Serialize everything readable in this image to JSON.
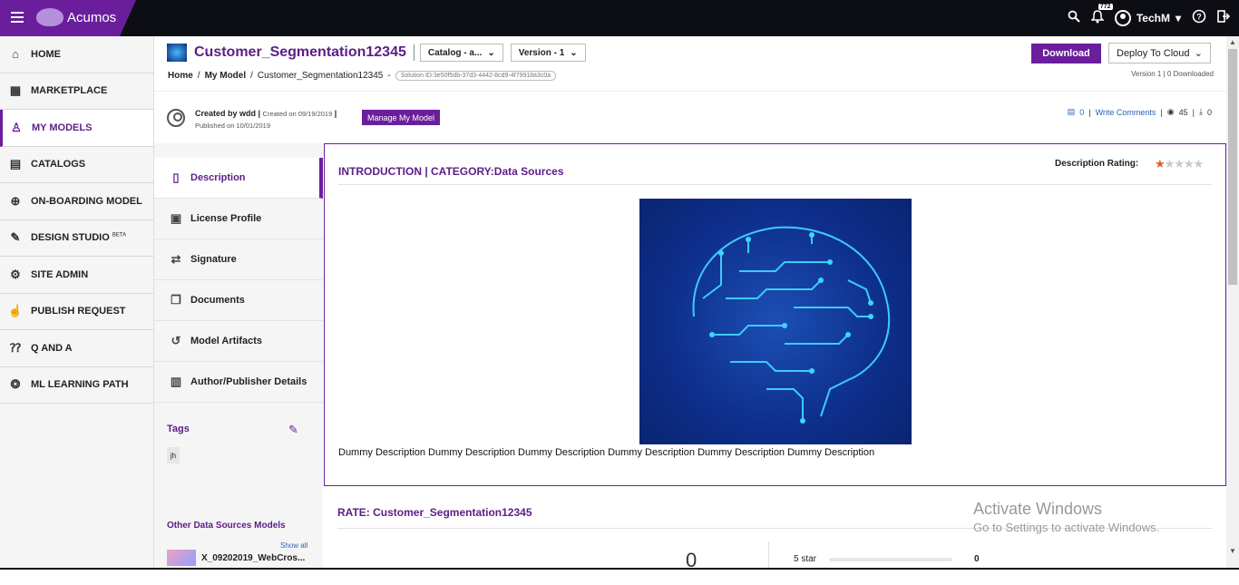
{
  "topbar": {
    "brand": "Acumos",
    "notification_count": "772",
    "user_name": "TechM"
  },
  "sidebar": {
    "items": [
      {
        "label": "HOME",
        "icon": "home-icon"
      },
      {
        "label": "MARKETPLACE",
        "icon": "store-icon"
      },
      {
        "label": "MY MODELS",
        "icon": "person-icon"
      },
      {
        "label": "CATALOGS",
        "icon": "catalog-icon"
      },
      {
        "label": "ON-BOARDING MODEL",
        "icon": "onboarding-icon"
      },
      {
        "label": "DESIGN STUDIO",
        "icon": "design-icon",
        "sup": "BETA"
      },
      {
        "label": "SITE ADMIN",
        "icon": "admin-icon"
      },
      {
        "label": "PUBLISH REQUEST",
        "icon": "publish-icon"
      },
      {
        "label": "Q AND A",
        "icon": "qa-icon"
      },
      {
        "label": "ML LEARNING PATH",
        "icon": "learning-icon"
      }
    ],
    "active_index": 2
  },
  "header": {
    "title": "Customer_Segmentation12345",
    "catalog_dropdown": "Catalog - a...",
    "version_dropdown": "Version - 1",
    "download_label": "Download",
    "deploy_label": "Deploy To Cloud",
    "version_info": "Version 1 | 0 Downloaded"
  },
  "breadcrumb": {
    "home": "Home",
    "my_model": "My Model",
    "current": "Customer_Segmentation12345",
    "solution_id": "Solution ID:3e50f5db-37d3-4442-8cd9-4f79918a3c0a"
  },
  "meta": {
    "created_by": "Created by wdd",
    "created_on": "Created on 09/19/2019",
    "published_on": "Published on 10/01/2019",
    "manage_label": "Manage My Model",
    "comment_count": "0",
    "write_comments": "Write Comments",
    "views": "45",
    "downloads": "0"
  },
  "tabs": [
    {
      "label": "Description",
      "icon": "description-icon"
    },
    {
      "label": "License Profile",
      "icon": "license-icon"
    },
    {
      "label": "Signature",
      "icon": "signature-icon"
    },
    {
      "label": "Documents",
      "icon": "documents-icon"
    },
    {
      "label": "Model Artifacts",
      "icon": "history-icon"
    },
    {
      "label": "Author/Publisher Details",
      "icon": "author-icon"
    }
  ],
  "tags": {
    "header": "Tags",
    "items": [
      "jh"
    ]
  },
  "other_models": {
    "header": "Other Data Sources Models",
    "show_all": "Show all",
    "first_item": "X_09202019_WebCros..."
  },
  "description": {
    "heading": "INTRODUCTION | CATEGORY:Data Sources",
    "rating_label": "Description Rating:",
    "rating_value": 1,
    "rating_max": 5,
    "text": "Dummy Description Dummy Description Dummy Description Dummy Description  Dummy Description  Dummy Description"
  },
  "rate": {
    "heading": "RATE: Customer_Segmentation12345",
    "average": "0",
    "star_label": "5 star",
    "star_count": "0"
  },
  "watermark": {
    "line1": "Activate Windows",
    "line2": "Go to Settings to activate Windows."
  },
  "colors": {
    "accent": "#6a1e9c",
    "star_active": "#e45b1d"
  }
}
